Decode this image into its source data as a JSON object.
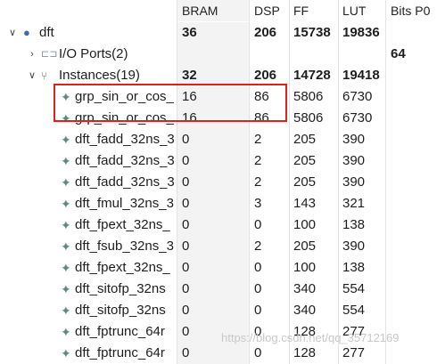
{
  "columns": {
    "bram": "BRAM",
    "dsp": "DSP",
    "ff": "FF",
    "lut": "LUT",
    "bits": "Bits P0"
  },
  "rows": [
    {
      "name": "dft",
      "bram": "36",
      "dsp": "206",
      "ff": "15738",
      "lut": "19836",
      "bits": "",
      "bold": true,
      "level": 0,
      "twisty": "∨",
      "icon": "module-dot-icon"
    },
    {
      "name": "I/O Ports(2)",
      "bram": "",
      "dsp": "",
      "ff": "",
      "lut": "",
      "bits": "64",
      "bold": false,
      "level": 1,
      "twisty": "›",
      "icon": "io-ports-icon"
    },
    {
      "name": "Instances(19)",
      "bram": "32",
      "dsp": "206",
      "ff": "14728",
      "lut": "19418",
      "bits": "",
      "bold": true,
      "level": 1,
      "twisty": "∨",
      "icon": "instances-tree-icon"
    },
    {
      "name": "grp_sin_or_cos_",
      "bram": "16",
      "dsp": "86",
      "ff": "5806",
      "lut": "6730",
      "bits": "",
      "bold": false,
      "level": 2,
      "icon": "instance-icon"
    },
    {
      "name": "grp_sin_or_cos_",
      "bram": "16",
      "dsp": "86",
      "ff": "5806",
      "lut": "6730",
      "bits": "",
      "bold": false,
      "level": 2,
      "icon": "instance-icon"
    },
    {
      "name": "dft_fadd_32ns_3",
      "bram": "0",
      "dsp": "2",
      "ff": "205",
      "lut": "390",
      "bits": "",
      "bold": false,
      "level": 2,
      "icon": "instance-icon"
    },
    {
      "name": "dft_fadd_32ns_3",
      "bram": "0",
      "dsp": "2",
      "ff": "205",
      "lut": "390",
      "bits": "",
      "bold": false,
      "level": 2,
      "icon": "instance-icon"
    },
    {
      "name": "dft_fadd_32ns_3",
      "bram": "0",
      "dsp": "2",
      "ff": "205",
      "lut": "390",
      "bits": "",
      "bold": false,
      "level": 2,
      "icon": "instance-icon"
    },
    {
      "name": "dft_fmul_32ns_3",
      "bram": "0",
      "dsp": "3",
      "ff": "143",
      "lut": "321",
      "bits": "",
      "bold": false,
      "level": 2,
      "icon": "instance-icon"
    },
    {
      "name": "dft_fpext_32ns_",
      "bram": "0",
      "dsp": "0",
      "ff": "100",
      "lut": "138",
      "bits": "",
      "bold": false,
      "level": 2,
      "icon": "instance-icon"
    },
    {
      "name": "dft_fsub_32ns_3",
      "bram": "0",
      "dsp": "2",
      "ff": "205",
      "lut": "390",
      "bits": "",
      "bold": false,
      "level": 2,
      "icon": "instance-icon"
    },
    {
      "name": "dft_fpext_32ns_",
      "bram": "0",
      "dsp": "0",
      "ff": "100",
      "lut": "138",
      "bits": "",
      "bold": false,
      "level": 2,
      "icon": "instance-icon"
    },
    {
      "name": "dft_sitofp_32ns",
      "bram": "0",
      "dsp": "0",
      "ff": "340",
      "lut": "554",
      "bits": "",
      "bold": false,
      "level": 2,
      "icon": "instance-icon"
    },
    {
      "name": "dft_sitofp_32ns",
      "bram": "0",
      "dsp": "0",
      "ff": "340",
      "lut": "554",
      "bits": "",
      "bold": false,
      "level": 2,
      "icon": "instance-icon"
    },
    {
      "name": "dft_fptrunc_64r",
      "bram": "0",
      "dsp": "0",
      "ff": "128",
      "lut": "277",
      "bits": "",
      "bold": false,
      "level": 2,
      "icon": "instance-icon"
    },
    {
      "name": "dft_fptrunc_64r",
      "bram": "0",
      "dsp": "0",
      "ff": "128",
      "lut": "277",
      "bits": "",
      "bold": false,
      "level": 2,
      "icon": "instance-icon"
    }
  ],
  "watermark": "https://blog.csdn.net/qq_35712169",
  "colors": {
    "highlight": "#e0201b",
    "bram_column_bg": "#f3f3f3"
  }
}
